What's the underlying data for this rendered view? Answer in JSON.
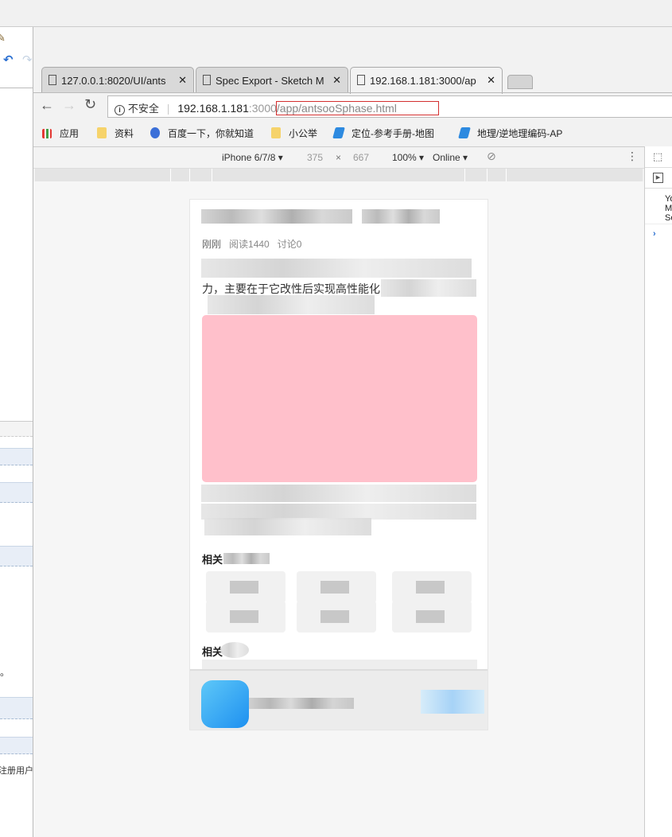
{
  "left_panel": {
    "stray_text_1": "。",
    "stray_text_2": "注册用户"
  },
  "tabs": [
    {
      "label": "127.0.0.1:8020/UI/ants",
      "active": false
    },
    {
      "label": "Spec Export - Sketch M",
      "active": false
    },
    {
      "label": "192.168.1.181:3000/ap",
      "active": true
    }
  ],
  "address_bar": {
    "security": "不安全",
    "host": "192.168.1.181",
    "port": ":3000",
    "path": "/app/antsooSphase.html"
  },
  "bookmarks": [
    {
      "label": "应用",
      "icon": "apps-grid-icon"
    },
    {
      "label": "资料",
      "icon": "folder-icon"
    },
    {
      "label": "百度一下，你就知道",
      "icon": "baidu-paw-icon"
    },
    {
      "label": "小公举",
      "icon": "folder-icon"
    },
    {
      "label": "定位-参考手册-地图",
      "icon": "amap-icon"
    },
    {
      "label": "地理/逆地理编码-AP",
      "icon": "amap-icon"
    }
  ],
  "device_toolbar": {
    "device": "iPhone 6/7/8",
    "width": "375",
    "x": "×",
    "height": "667",
    "zoom": "100%",
    "network": "Online"
  },
  "devtools_console": [
    "Yo",
    "Ma",
    "Se"
  ],
  "article": {
    "meta": {
      "time": "刚刚",
      "reads": "阅读1440",
      "comments": "讨论0"
    },
    "body_line": "力，主要在于它改性后实现高性能化",
    "image_color": "#ffc0cb",
    "section1_title": "相关",
    "section2_title": "相关"
  },
  "colors": {
    "accent_blue": "#2196f3",
    "image_pink": "#ffc0cb"
  }
}
